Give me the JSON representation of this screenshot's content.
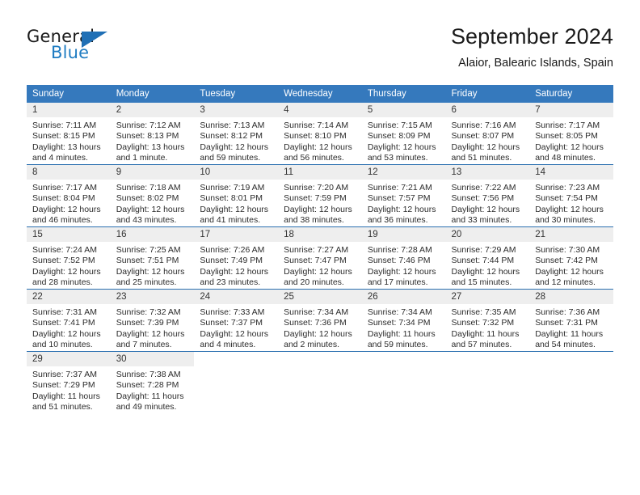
{
  "brand": {
    "name_part1": "General",
    "name_part2": "Blue",
    "logo_icon": "triangle-flag-icon"
  },
  "header": {
    "title": "September 2024",
    "subtitle": "Alaior, Balearic Islands, Spain"
  },
  "colors": {
    "header_blue": "#3579bd",
    "separator_blue": "#2a6fb0",
    "daynum_band": "#eeeeee",
    "brand_blue": "#1f7cc2",
    "text": "#2b2b2b"
  },
  "calendar": {
    "weekday_headers": [
      "Sunday",
      "Monday",
      "Tuesday",
      "Wednesday",
      "Thursday",
      "Friday",
      "Saturday"
    ],
    "weeks": [
      [
        {
          "day": "1",
          "sunrise": "Sunrise: 7:11 AM",
          "sunset": "Sunset: 8:15 PM",
          "daylight": "Daylight: 13 hours and 4 minutes."
        },
        {
          "day": "2",
          "sunrise": "Sunrise: 7:12 AM",
          "sunset": "Sunset: 8:13 PM",
          "daylight": "Daylight: 13 hours and 1 minute."
        },
        {
          "day": "3",
          "sunrise": "Sunrise: 7:13 AM",
          "sunset": "Sunset: 8:12 PM",
          "daylight": "Daylight: 12 hours and 59 minutes."
        },
        {
          "day": "4",
          "sunrise": "Sunrise: 7:14 AM",
          "sunset": "Sunset: 8:10 PM",
          "daylight": "Daylight: 12 hours and 56 minutes."
        },
        {
          "day": "5",
          "sunrise": "Sunrise: 7:15 AM",
          "sunset": "Sunset: 8:09 PM",
          "daylight": "Daylight: 12 hours and 53 minutes."
        },
        {
          "day": "6",
          "sunrise": "Sunrise: 7:16 AM",
          "sunset": "Sunset: 8:07 PM",
          "daylight": "Daylight: 12 hours and 51 minutes."
        },
        {
          "day": "7",
          "sunrise": "Sunrise: 7:17 AM",
          "sunset": "Sunset: 8:05 PM",
          "daylight": "Daylight: 12 hours and 48 minutes."
        }
      ],
      [
        {
          "day": "8",
          "sunrise": "Sunrise: 7:17 AM",
          "sunset": "Sunset: 8:04 PM",
          "daylight": "Daylight: 12 hours and 46 minutes."
        },
        {
          "day": "9",
          "sunrise": "Sunrise: 7:18 AM",
          "sunset": "Sunset: 8:02 PM",
          "daylight": "Daylight: 12 hours and 43 minutes."
        },
        {
          "day": "10",
          "sunrise": "Sunrise: 7:19 AM",
          "sunset": "Sunset: 8:01 PM",
          "daylight": "Daylight: 12 hours and 41 minutes."
        },
        {
          "day": "11",
          "sunrise": "Sunrise: 7:20 AM",
          "sunset": "Sunset: 7:59 PM",
          "daylight": "Daylight: 12 hours and 38 minutes."
        },
        {
          "day": "12",
          "sunrise": "Sunrise: 7:21 AM",
          "sunset": "Sunset: 7:57 PM",
          "daylight": "Daylight: 12 hours and 36 minutes."
        },
        {
          "day": "13",
          "sunrise": "Sunrise: 7:22 AM",
          "sunset": "Sunset: 7:56 PM",
          "daylight": "Daylight: 12 hours and 33 minutes."
        },
        {
          "day": "14",
          "sunrise": "Sunrise: 7:23 AM",
          "sunset": "Sunset: 7:54 PM",
          "daylight": "Daylight: 12 hours and 30 minutes."
        }
      ],
      [
        {
          "day": "15",
          "sunrise": "Sunrise: 7:24 AM",
          "sunset": "Sunset: 7:52 PM",
          "daylight": "Daylight: 12 hours and 28 minutes."
        },
        {
          "day": "16",
          "sunrise": "Sunrise: 7:25 AM",
          "sunset": "Sunset: 7:51 PM",
          "daylight": "Daylight: 12 hours and 25 minutes."
        },
        {
          "day": "17",
          "sunrise": "Sunrise: 7:26 AM",
          "sunset": "Sunset: 7:49 PM",
          "daylight": "Daylight: 12 hours and 23 minutes."
        },
        {
          "day": "18",
          "sunrise": "Sunrise: 7:27 AM",
          "sunset": "Sunset: 7:47 PM",
          "daylight": "Daylight: 12 hours and 20 minutes."
        },
        {
          "day": "19",
          "sunrise": "Sunrise: 7:28 AM",
          "sunset": "Sunset: 7:46 PM",
          "daylight": "Daylight: 12 hours and 17 minutes."
        },
        {
          "day": "20",
          "sunrise": "Sunrise: 7:29 AM",
          "sunset": "Sunset: 7:44 PM",
          "daylight": "Daylight: 12 hours and 15 minutes."
        },
        {
          "day": "21",
          "sunrise": "Sunrise: 7:30 AM",
          "sunset": "Sunset: 7:42 PM",
          "daylight": "Daylight: 12 hours and 12 minutes."
        }
      ],
      [
        {
          "day": "22",
          "sunrise": "Sunrise: 7:31 AM",
          "sunset": "Sunset: 7:41 PM",
          "daylight": "Daylight: 12 hours and 10 minutes."
        },
        {
          "day": "23",
          "sunrise": "Sunrise: 7:32 AM",
          "sunset": "Sunset: 7:39 PM",
          "daylight": "Daylight: 12 hours and 7 minutes."
        },
        {
          "day": "24",
          "sunrise": "Sunrise: 7:33 AM",
          "sunset": "Sunset: 7:37 PM",
          "daylight": "Daylight: 12 hours and 4 minutes."
        },
        {
          "day": "25",
          "sunrise": "Sunrise: 7:34 AM",
          "sunset": "Sunset: 7:36 PM",
          "daylight": "Daylight: 12 hours and 2 minutes."
        },
        {
          "day": "26",
          "sunrise": "Sunrise: 7:34 AM",
          "sunset": "Sunset: 7:34 PM",
          "daylight": "Daylight: 11 hours and 59 minutes."
        },
        {
          "day": "27",
          "sunrise": "Sunrise: 7:35 AM",
          "sunset": "Sunset: 7:32 PM",
          "daylight": "Daylight: 11 hours and 57 minutes."
        },
        {
          "day": "28",
          "sunrise": "Sunrise: 7:36 AM",
          "sunset": "Sunset: 7:31 PM",
          "daylight": "Daylight: 11 hours and 54 minutes."
        }
      ],
      [
        {
          "day": "29",
          "sunrise": "Sunrise: 7:37 AM",
          "sunset": "Sunset: 7:29 PM",
          "daylight": "Daylight: 11 hours and 51 minutes."
        },
        {
          "day": "30",
          "sunrise": "Sunrise: 7:38 AM",
          "sunset": "Sunset: 7:28 PM",
          "daylight": "Daylight: 11 hours and 49 minutes."
        },
        {
          "day": "",
          "sunrise": "",
          "sunset": "",
          "daylight": ""
        },
        {
          "day": "",
          "sunrise": "",
          "sunset": "",
          "daylight": ""
        },
        {
          "day": "",
          "sunrise": "",
          "sunset": "",
          "daylight": ""
        },
        {
          "day": "",
          "sunrise": "",
          "sunset": "",
          "daylight": ""
        },
        {
          "day": "",
          "sunrise": "",
          "sunset": "",
          "daylight": ""
        }
      ]
    ]
  }
}
